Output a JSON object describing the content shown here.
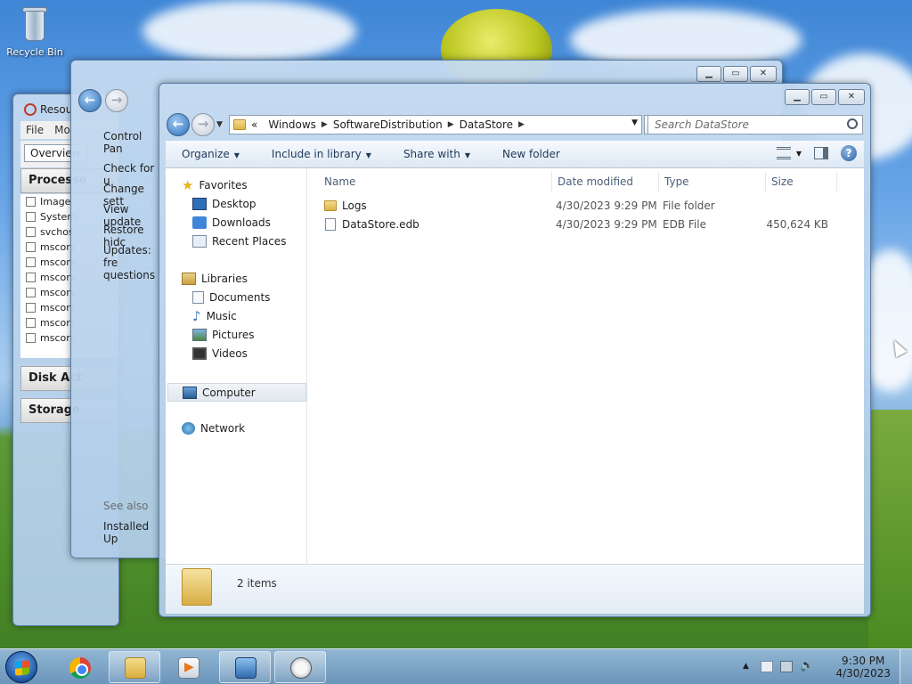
{
  "desktop": {
    "recycle_bin_label": "Recycle Bin"
  },
  "resource_monitor": {
    "title": "Resou",
    "menu": [
      "File",
      "Mo"
    ],
    "tab_overview": "Overview",
    "section_processes": "Processe",
    "processes": [
      "Image",
      "System",
      "svchos",
      "mscors",
      "mscors",
      "mscors",
      "mscors",
      "mscors",
      "mscors",
      "mscors"
    ],
    "section_disk": "Disk Act",
    "section_storage": "Storage"
  },
  "windows_update": {
    "nav_label": "Control Pan",
    "links": [
      "Check for u",
      "Change sett",
      "View update",
      "Restore hidc",
      "Updates: fre questions"
    ],
    "see_also": "See also",
    "installed": "Installed Up"
  },
  "explorer": {
    "address": {
      "overflow": "«",
      "segments": [
        "Windows",
        "SoftwareDistribution",
        "DataStore"
      ]
    },
    "search_placeholder": "Search DataStore",
    "toolbar": {
      "organize": "Organize",
      "include_in_library": "Include in library",
      "share_with": "Share with",
      "new_folder": "New folder"
    },
    "nav": {
      "favorites": "Favorites",
      "desktop": "Desktop",
      "downloads": "Downloads",
      "recent_places": "Recent Places",
      "libraries": "Libraries",
      "documents": "Documents",
      "music": "Music",
      "pictures": "Pictures",
      "videos": "Videos",
      "computer": "Computer",
      "network": "Network"
    },
    "columns": {
      "name": "Name",
      "date_modified": "Date modified",
      "type": "Type",
      "size": "Size"
    },
    "files": [
      {
        "name": "Logs",
        "date": "4/30/2023 9:29 PM",
        "type": "File folder",
        "size": ""
      },
      {
        "name": "DataStore.edb",
        "date": "4/30/2023 9:29 PM",
        "type": "EDB File",
        "size": "450,624 KB"
      }
    ],
    "item_count": "2 items"
  },
  "taskbar": {
    "time": "9:30 PM",
    "date": "4/30/2023"
  }
}
